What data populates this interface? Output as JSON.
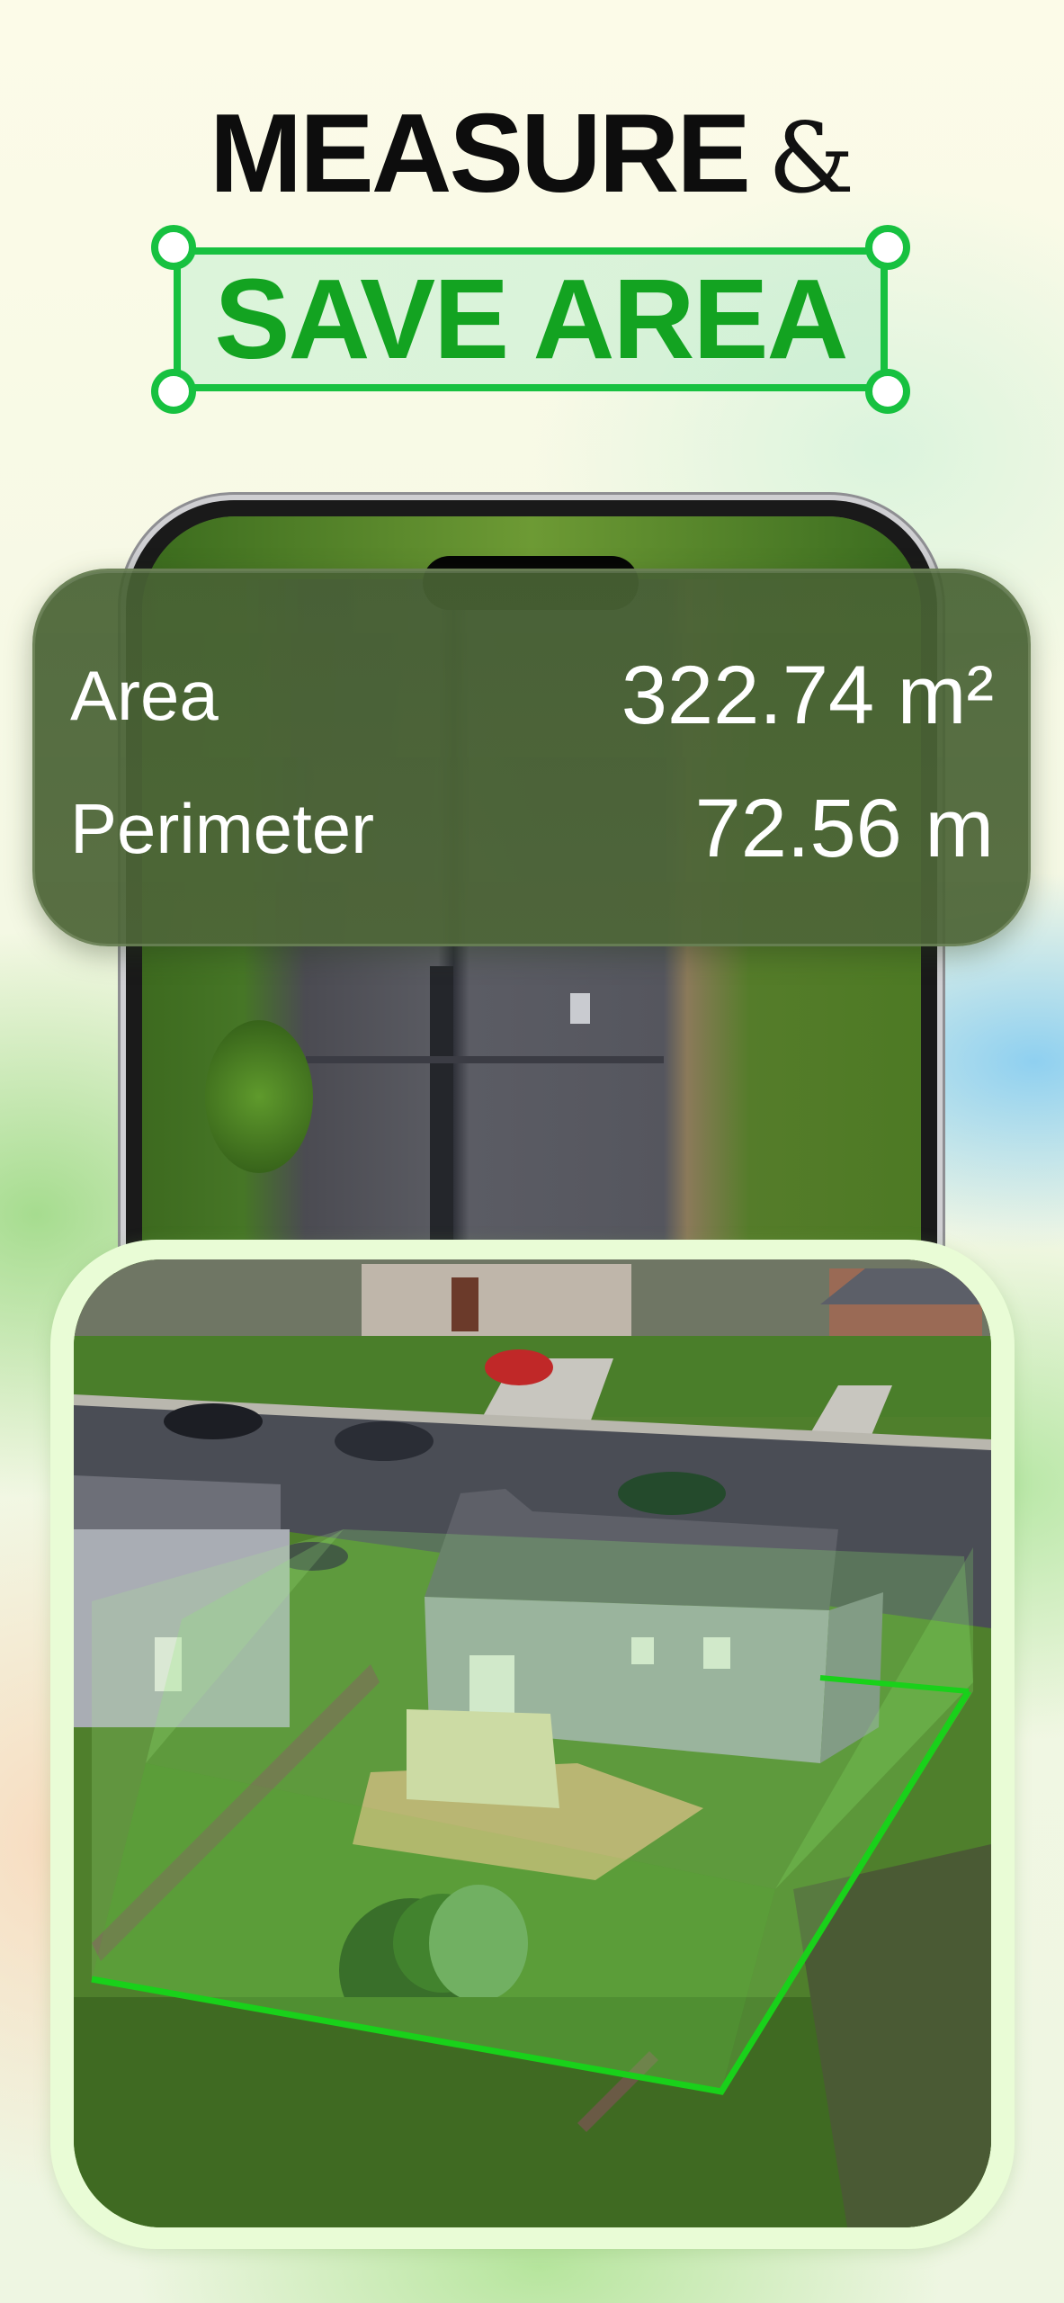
{
  "headline": {
    "line1": "MEASURE",
    "ampersand": "&",
    "line2": "SAVE AREA"
  },
  "measurement": {
    "area_label": "Area",
    "area_value": "322.74 m²",
    "perimeter_label": "Perimeter",
    "perimeter_value": "72.56 m"
  },
  "colors": {
    "accent_green": "#17c140",
    "headline_green": "#13a321",
    "card_background": "#4a6436",
    "highlight_fill": "rgba(120,230,90,0.35)",
    "outline_green": "#19d11a"
  },
  "icons": {
    "selection_handles": "corner-handle-icon"
  }
}
